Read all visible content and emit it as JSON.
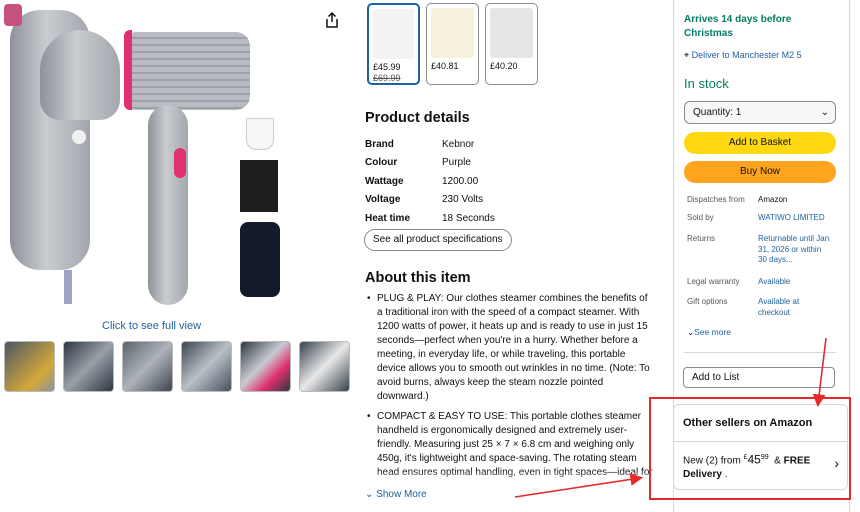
{
  "gallery": {
    "click_to_full": "Click to see full view",
    "thumbnails": [
      "thumb-1",
      "thumb-2",
      "thumb-3",
      "thumb-4",
      "thumb-5",
      "thumb-6"
    ]
  },
  "variants": [
    {
      "price": "£45.99",
      "was": "£69.99",
      "selected": true
    },
    {
      "price": "£40.81",
      "was": "",
      "selected": false
    },
    {
      "price": "£40.20",
      "was": "",
      "selected": false
    }
  ],
  "product_details": {
    "title": "Product details",
    "rows": [
      {
        "key": "Brand",
        "value": "Kebnor"
      },
      {
        "key": "Colour",
        "value": "Purple"
      },
      {
        "key": "Wattage",
        "value": "1200.00"
      },
      {
        "key": "Voltage",
        "value": "230 Volts"
      },
      {
        "key": "Heat time",
        "value": "18 Seconds"
      }
    ],
    "see_all": "See all product specifications"
  },
  "about": {
    "title": "About this item",
    "bullets": [
      "PLUG & PLAY: Our clothes steamer combines the benefits of a traditional iron with the speed of a compact steamer. With 1200 watts of power, it heats up and is ready to use in just 15 seconds—perfect when you're in a hurry. Whether before a meeting, in everyday life, or while traveling, this portable device allows you to smooth out wrinkles in no time. (Note: To avoid burns, always keep the steam nozzle pointed downward.)",
      "COMPACT & EASY TO USE: This portable clothes steamer handheld is ergonomically designed and extremely user-friendly. Measuring just 25 × 7 × 6.8 cm and weighing only 450g, it's lightweight and space-saving. The rotating steam head ensures optimal handling, even in tight spaces—ideal for your backpack or suitcase. Comes with a storage"
    ],
    "show_more": "Show More"
  },
  "buybox": {
    "arrives": "Arrives 14 days before Christmas",
    "deliver": "Deliver to Manchester M2 5",
    "in_stock": "In stock",
    "quantity": "Quantity: 1",
    "add_to_basket": "Add to Basket",
    "buy_now": "Buy Now",
    "info": [
      {
        "label": "Dispatches from",
        "value": "Amazon",
        "link": false
      },
      {
        "label": "Sold by",
        "value": "WATIWO LIMITED",
        "link": true
      },
      {
        "label": "Returns",
        "value": "Returnable until Jan 31, 2026 or within 30 days...",
        "link": true
      },
      {
        "label": "Legal warranty",
        "value": "Available",
        "link": true
      },
      {
        "label": "Gift options",
        "value": "Available at checkout",
        "link": true
      }
    ],
    "see_more": "See more",
    "add_to_list": "Add to List"
  },
  "other_sellers": {
    "title": "Other sellers on Amazon",
    "offer_prefix": "New (2) from ",
    "price_symbol": "£",
    "price_whole": "45",
    "price_fraction": "99",
    "free": "FREE",
    "delivery": "Delivery"
  },
  "annotation_color": "#e32b2b"
}
